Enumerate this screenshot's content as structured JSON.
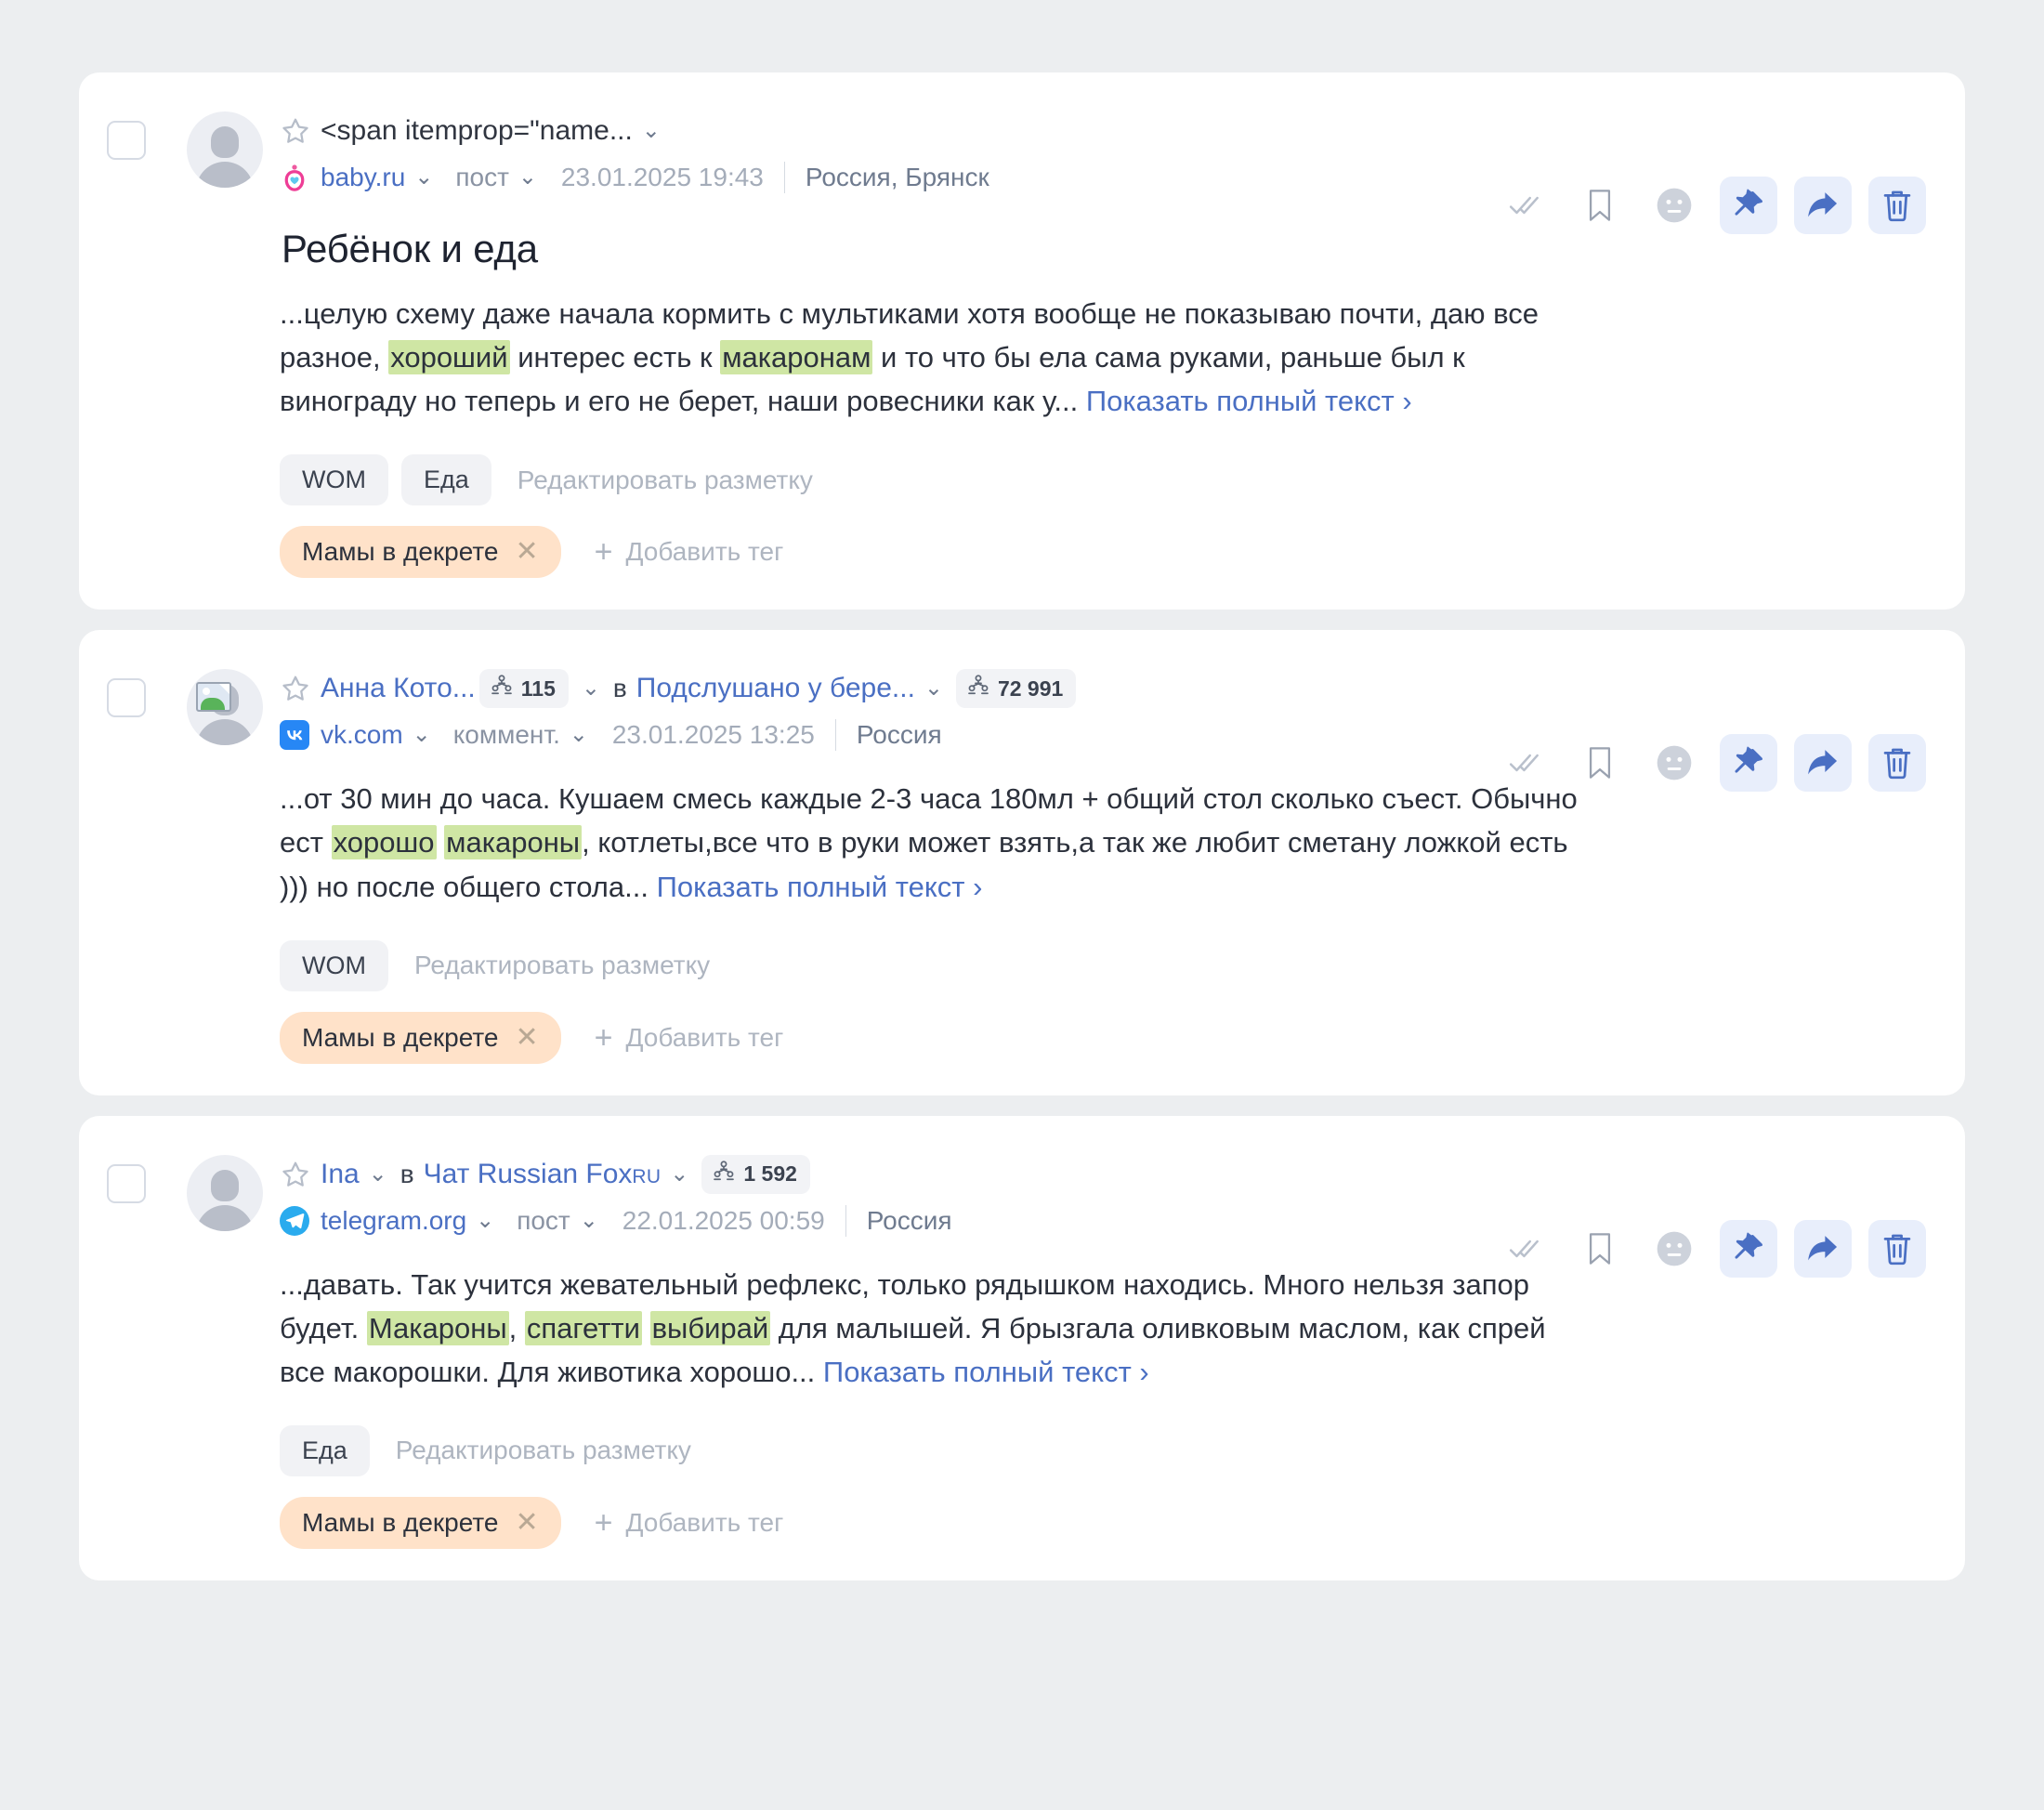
{
  "theme": {
    "page_bg": "#eceef0",
    "card_bg": "#ffffff",
    "link_blue": "#4a6fc3",
    "highlight_green": "#cfe6a4",
    "chip_gray": "#f1f2f5",
    "chip_orange": "#ffe2c9",
    "action_active_bg": "#e8eefb"
  },
  "common": {
    "show_more": "Показать полный текст ",
    "show_more_chevron": "›",
    "edit_markup": "Редактировать разметку",
    "add_tag": "Добавить тег",
    "plus": "+",
    "chevron_down": "⌄",
    "remove_tag": "✕",
    "in_word": "в"
  },
  "actions": [
    {
      "name": "approve-icon",
      "label": "Обработано",
      "active": false
    },
    {
      "name": "bookmark-icon",
      "label": "В закладки",
      "active": false
    },
    {
      "name": "neutral-face-icon",
      "label": "Тональность",
      "active": false
    },
    {
      "name": "pin-icon",
      "label": "Закрепить",
      "active": true
    },
    {
      "name": "share-icon",
      "label": "Поделиться",
      "active": true
    },
    {
      "name": "trash-icon",
      "label": "Удалить",
      "active": true
    }
  ],
  "cards": [
    {
      "id": "card-1",
      "checked": false,
      "avatar": "person-placeholder",
      "author": "<span itemprop=\"name...",
      "author_is_code": true,
      "author_followers": null,
      "group": null,
      "group_followers": null,
      "source": "baby.ru",
      "favicon": "baby-ru-icon",
      "kind": "пост",
      "date": "23.01.2025 19:43",
      "geo": "Россия, Брянск",
      "title": "Ребёнок и еда",
      "text_parts": [
        {
          "t": "...целую схему даже начала кормить с мультиками хотя вообще не показываю почти, даю все разное, ",
          "h": false
        },
        {
          "t": "хороший",
          "h": true
        },
        {
          "t": " интерес есть к ",
          "h": false
        },
        {
          "t": "макаронам",
          "h": true
        },
        {
          "t": " и то что бы ела сама руками, раньше был к винограду но теперь и его не берет, наши ровесники как у... ",
          "h": false
        }
      ],
      "markup_tags": [
        "WOM",
        "Еда"
      ],
      "user_tags": [
        "Мамы в декрете"
      ]
    },
    {
      "id": "card-2",
      "checked": false,
      "avatar": "broken-image-placeholder",
      "author": "Анна Кото...",
      "author_is_code": false,
      "author_followers": "115",
      "group": "Подслушано у бере...",
      "group_followers": "72 991",
      "source": "vk.com",
      "favicon": "vk-icon",
      "kind": "коммент.",
      "date": "23.01.2025 13:25",
      "geo": "Россия",
      "title": null,
      "text_parts": [
        {
          "t": "...от 30 мин до часа. Кушаем смесь каждые 2-3 часа 180мл + общий стол сколько съест. Обычно ест ",
          "h": false
        },
        {
          "t": "хорошо",
          "h": true
        },
        {
          "t": " ",
          "h": false
        },
        {
          "t": "макароны",
          "h": true
        },
        {
          "t": ", котлеты,все что в руки может взять,а так же любит сметану ложкой есть ))) но после общего стола... ",
          "h": false
        }
      ],
      "markup_tags": [
        "WOM"
      ],
      "user_tags": [
        "Мамы в декрете"
      ]
    },
    {
      "id": "card-3",
      "checked": false,
      "avatar": "person-placeholder",
      "author": "Ina",
      "author_is_code": false,
      "author_followers": null,
      "group": "Чат Russian Fox",
      "group_suffix": "RU",
      "group_followers": "1 592",
      "source": "telegram.org",
      "favicon": "telegram-icon",
      "kind": "пост",
      "date": "22.01.2025 00:59",
      "geo": "Россия",
      "title": null,
      "text_parts": [
        {
          "t": "...давать. Так учится жевательный рефлекс, только рядышком находись. Много нельзя запор будет. ",
          "h": false
        },
        {
          "t": "Макароны",
          "h": true
        },
        {
          "t": ", ",
          "h": false
        },
        {
          "t": "спагетти",
          "h": true
        },
        {
          "t": " ",
          "h": false
        },
        {
          "t": "выбирай",
          "h": true
        },
        {
          "t": " для малышей. Я брызгала оливковым маслом, как спрей все макорошки. Для животика хорошо... ",
          "h": false
        }
      ],
      "markup_tags": [
        "Еда"
      ],
      "user_tags": [
        "Мамы в декрете"
      ]
    }
  ]
}
